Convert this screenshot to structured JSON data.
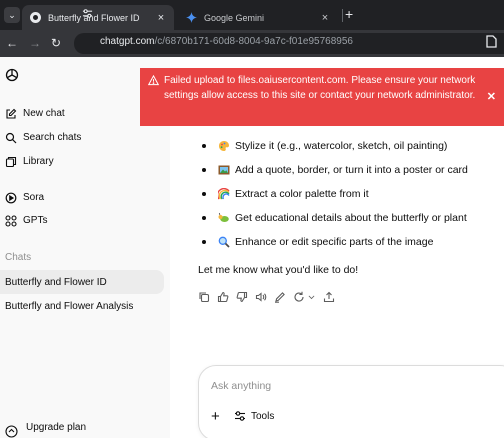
{
  "browser": {
    "tabs": [
      {
        "title": "Butterfly and Flower ID",
        "active": true
      },
      {
        "title": "Google Gemini",
        "active": false
      }
    ],
    "url": {
      "host": "chatgpt.com",
      "path": "/c/6870b171-60d8-8004-9a7c-f01e95768956"
    }
  },
  "sidebar": {
    "items": [
      {
        "label": "New chat",
        "icon": "new-chat-icon"
      },
      {
        "label": "Search chats",
        "icon": "search-icon"
      },
      {
        "label": "Library",
        "icon": "library-icon"
      },
      {
        "label": "Sora",
        "icon": "sora-icon"
      },
      {
        "label": "GPTs",
        "icon": "gpts-icon"
      }
    ],
    "chats_heading": "Chats",
    "chats": [
      {
        "label": "Butterfly and Flower ID",
        "active": true
      },
      {
        "label": "Butterfly and Flower Analysis",
        "active": false
      }
    ],
    "upgrade_label": "Upgrade plan"
  },
  "error_banner": {
    "message": "Failed upload to files.oaiusercontent.com. Please ensure your network settings allow access to this site or contact your network administrator.",
    "close": "✕"
  },
  "message": {
    "bullets": [
      {
        "emoji": "palette-icon",
        "text": "Stylize it (e.g., watercolor, sketch, oil painting)"
      },
      {
        "emoji": "picture-frame-icon",
        "text": "Add a quote, border, or turn it into a poster or card"
      },
      {
        "emoji": "rainbow-icon",
        "text": "Extract a color palette from it"
      },
      {
        "emoji": "leaf-bug-icon",
        "text": "Get educational details about the butterfly or plant"
      },
      {
        "emoji": "magnifier-icon",
        "text": "Enhance or edit specific parts of the image"
      }
    ],
    "closing": "Let me know what you'd like to do!"
  },
  "composer": {
    "placeholder": "Ask anything",
    "tools_label": "Tools"
  },
  "colors": {
    "error_banner": "#e84343",
    "sidebar_bg": "#f9f9f9",
    "chrome_bg": "#202124"
  }
}
